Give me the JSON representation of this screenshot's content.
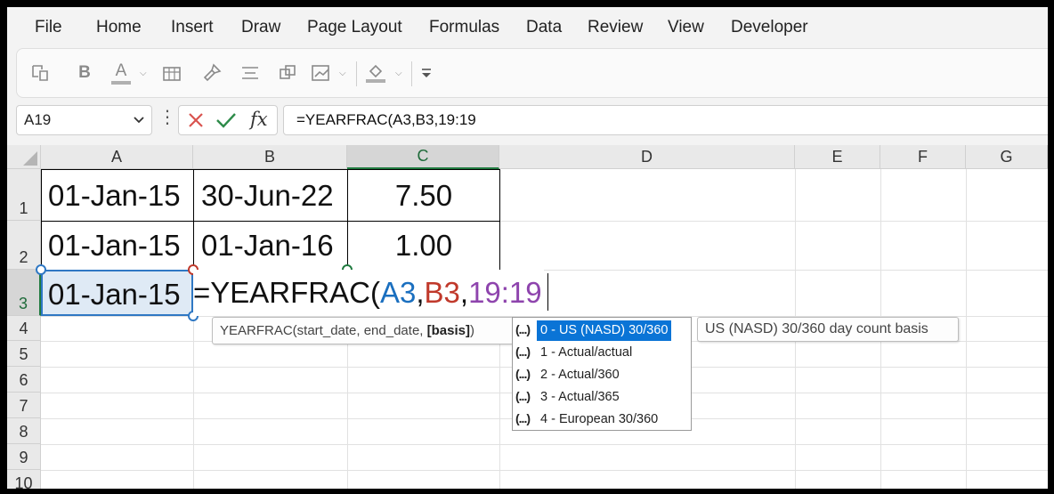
{
  "menu": [
    "File",
    "Home",
    "Insert",
    "Draw",
    "Page Layout",
    "Formulas",
    "Data",
    "Review",
    "View",
    "Developer"
  ],
  "ribbon": {
    "icons": [
      "paste-special-icon",
      "bold-icon",
      "font-color-icon",
      "insert-table-icon",
      "format-painter-icon",
      "align-center-icon",
      "objects-icon",
      "chart-icon",
      "fill-color-icon",
      "customize-toolbar-icon"
    ],
    "bold_label": "B",
    "font_color_label": "A"
  },
  "formula_bar": {
    "name_box": "A19",
    "fx_label": "fx",
    "formula": "=YEARFRAC(A3,B3,19:19"
  },
  "columns": [
    "A",
    "B",
    "C",
    "D",
    "E",
    "F",
    "G"
  ],
  "rows": [
    "1",
    "2",
    "3",
    "4",
    "5",
    "6",
    "7",
    "8",
    "9",
    "10"
  ],
  "cells": {
    "A1": "01-Jan-15",
    "B1": "30-Jun-22",
    "C1": "7.50",
    "A2": "01-Jan-15",
    "B2": "01-Jan-16",
    "C2": "1.00",
    "A3": "01-Jan-15"
  },
  "editor": {
    "func": "=YEARFRAC(",
    "arg1": "A3",
    "sep1": ",",
    "arg2": "B3",
    "sep2": ",",
    "arg3": "19:19"
  },
  "tooltip": {
    "signature": "YEARFRAC(start_date, end_date, ",
    "active_arg": "[basis]",
    "close": ")"
  },
  "dropdown": {
    "items": [
      {
        "icon": "(...)",
        "label": "0 - US (NASD) 30/360",
        "selected": true
      },
      {
        "icon": "(...)",
        "label": "1 - Actual/actual",
        "selected": false
      },
      {
        "icon": "(...)",
        "label": "2 - Actual/360",
        "selected": false
      },
      {
        "icon": "(...)",
        "label": "3 - Actual/365",
        "selected": false
      },
      {
        "icon": "(...)",
        "label": "4 - European 30/360",
        "selected": false
      }
    ],
    "description": "US (NASD) 30/360 day count basis"
  },
  "colors": {
    "accent_green": "#1f7a3f",
    "ref_a3": "#1a6fbf",
    "ref_b3": "#c0392b",
    "ref_arg": "#8e44ad",
    "selected_item": "#0a74d6"
  }
}
